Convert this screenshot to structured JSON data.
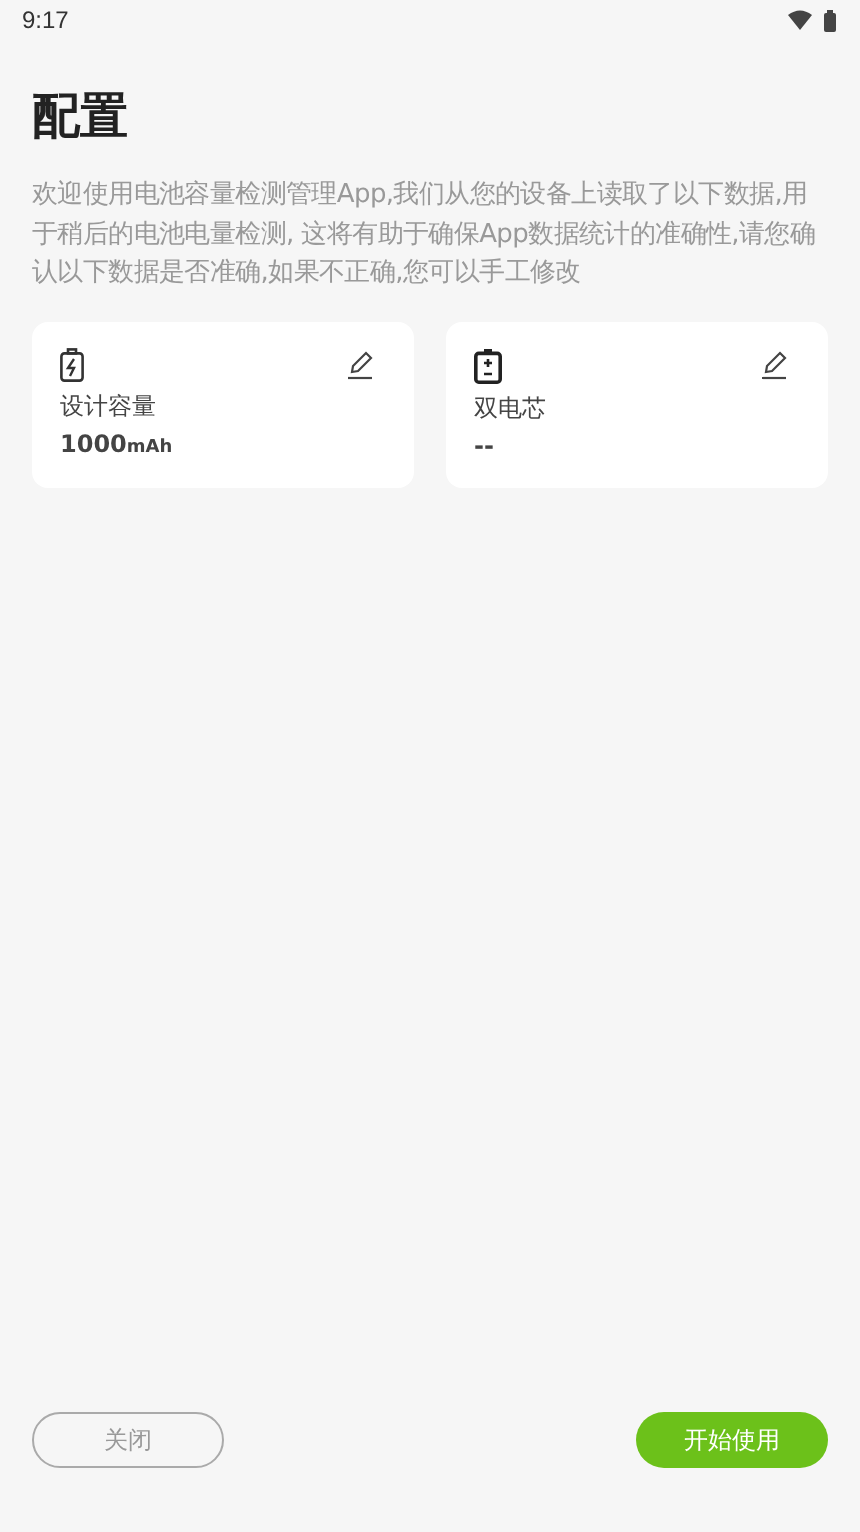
{
  "status_bar": {
    "time": "9:17"
  },
  "title": "配置",
  "description": "欢迎使用电池容量检测管理App,我们从您的设备上读取了以下数据,用于稍后的电池电量检测, 这将有助于确保App数据统计的准确性,请您确认以下数据是否准确,如果不正确,您可以手工修改",
  "cards": [
    {
      "kind": "charge",
      "label": "设计容量",
      "value": "1000",
      "unit": "mAh"
    },
    {
      "kind": "cell",
      "label": "双电芯",
      "value": "--"
    }
  ],
  "buttons": {
    "close": "关闭",
    "start": "开始使用"
  }
}
